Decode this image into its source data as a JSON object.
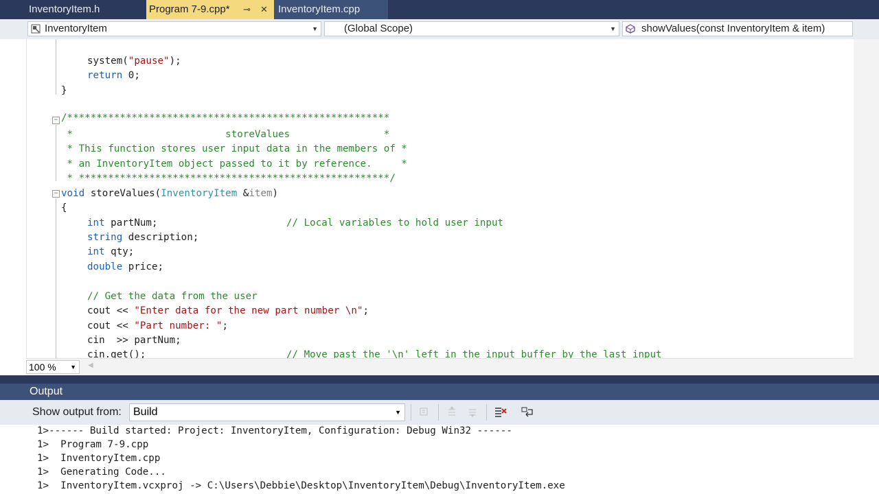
{
  "tabs": [
    {
      "label": "InventoryItem.h",
      "active": false
    },
    {
      "label": "Program 7-9.cpp*",
      "active": true
    },
    {
      "label": "InventoryItem.cpp",
      "active": false
    }
  ],
  "tab_pin_glyph": "⊸",
  "tab_close_glyph": "✕",
  "navbar": {
    "project_combo": "InventoryItem",
    "scope_combo": "(Global Scope)",
    "member_combo": "showValues(const InventoryItem & item)"
  },
  "code": {
    "l1_call": "system(",
    "l1_str": "\"pause\"",
    "l1_end": ");",
    "l2_kw": "return",
    "l2_rest": " 0;",
    "l3": "}",
    "c1": "/*******************************************************",
    "c2": " *                          storeValues                *",
    "c3": " * This function stores user input data in the members of *",
    "c4": " * an InventoryItem object passed to it by reference.     *",
    "c5": " * *****************************************************/",
    "f_kw": "void",
    "f_name": " storeValues(",
    "f_type": "InventoryItem",
    "f_amp": " &",
    "f_param": "item",
    "f_close": ")",
    "brace": "{",
    "d1_kw": "int",
    "d1_rest": " partNum;",
    "d1_cmt": "// Local variables to hold user input",
    "d2_kw": "string",
    "d2_rest": " description;",
    "d3_kw": "int",
    "d3_rest": " qty;",
    "d4_kw": "double",
    "d4_rest": " price;",
    "g_cmt": "// Get the data from the user",
    "o1_a": "cout << ",
    "o1_str": "\"Enter data for the new part number \\n\"",
    "o1_end": ";",
    "o2_a": "cout << ",
    "o2_str": "\"Part number: \"",
    "o2_end": ";",
    "i1": "cin  >> partNum;",
    "i2_a": "cin.get();",
    "i2_cmt": "// Move past the '\\n' left in the input buffer by the last input"
  },
  "zoom": "100 %",
  "output": {
    "title": "Output",
    "show_from_label": "Show output from:",
    "source": "Build",
    "lines": [
      "1>------ Build started: Project: InventoryItem, Configuration: Debug Win32 ------",
      "1>  Program 7-9.cpp",
      "1>  InventoryItem.cpp",
      "1>  Generating Code...",
      "1>  InventoryItem.vcxproj -> C:\\Users\\Debbie\\Desktop\\InventoryItem\\Debug\\InventoryItem.exe"
    ]
  },
  "colors": {
    "keyword": "#1d5fb5",
    "string": "#a31515",
    "comment": "#2d8a2d",
    "type": "#2b91af",
    "active_tab": "#f5d97e",
    "tab_strip": "#2b3a5c"
  }
}
